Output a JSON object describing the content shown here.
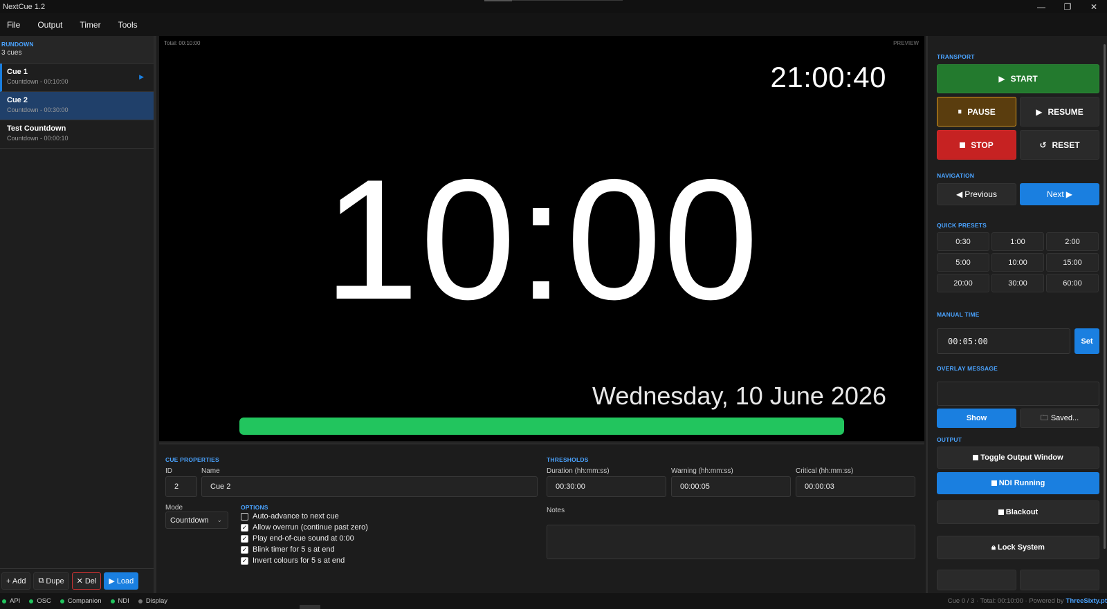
{
  "window": {
    "title": "NextCue  1.2",
    "controls": [
      "—",
      "❐",
      "✕"
    ]
  },
  "menu": [
    "File",
    "Output",
    "Timer",
    "Tools"
  ],
  "rundown": {
    "label": "RUNDOWN",
    "count": "3 cues",
    "cues": [
      {
        "name": "Cue 1",
        "sub": "Countdown - 00:10:00"
      },
      {
        "name": "Cue 2",
        "sub": "Countdown - 00:30:00"
      },
      {
        "name": "Test Countdown",
        "sub": "Countdown - 00:00:10"
      }
    ],
    "actions": {
      "add": "+ Add",
      "dupe": "Dupe",
      "del": "Del",
      "load": "Load"
    }
  },
  "preview": {
    "total_label": "Total:",
    "total_value": "00:10:00",
    "label": "PREVIEW",
    "clock": "21:00:40",
    "timer": "10:00",
    "date": "Wednesday, 10 June 2026",
    "progress": 1.0,
    "progress_color": "#22c55e"
  },
  "props": {
    "section": "CUE PROPERTIES",
    "id_label": "ID",
    "id_value": "2",
    "name_label": "Name",
    "name_value": "Cue 2",
    "mode_label": "Mode",
    "mode_value": "Countdown",
    "options_label": "OPTIONS",
    "options": [
      {
        "label": "Auto-advance to next cue",
        "checked": false
      },
      {
        "label": "Allow overrun (continue past zero)",
        "checked": true
      },
      {
        "label": "Play end-of-cue sound at 0:00",
        "checked": true
      },
      {
        "label": "Blink timer for 5 s at end",
        "checked": true
      },
      {
        "label": "Invert colours for 5 s at end",
        "checked": true
      }
    ],
    "thresholds_label": "THRESHOLDS",
    "duration_label": "Duration (hh:mm:ss)",
    "duration_value": "00:30:00",
    "warning_label": "Warning (hh:mm:ss)",
    "warning_value": "00:00:05",
    "critical_label": "Critical (hh:mm:ss)",
    "critical_value": "00:00:03",
    "notes_label": "Notes"
  },
  "transport": {
    "label": "TRANSPORT",
    "start": "START",
    "pause": "PAUSE",
    "resume": "RESUME",
    "stop": "STOP",
    "reset": "RESET"
  },
  "navigation": {
    "label": "NAVIGATION",
    "previous": "Previous",
    "next": "Next"
  },
  "presets": {
    "label": "QUICK PRESETS",
    "items": [
      "0:30",
      "1:00",
      "2:00",
      "5:00",
      "10:00",
      "15:00",
      "20:00",
      "30:00",
      "60:00"
    ]
  },
  "manual": {
    "label": "MANUAL TIME",
    "value": "00:05:00",
    "set": "Set"
  },
  "overlay": {
    "label": "OVERLAY MESSAGE",
    "show": "Show",
    "saved": "Saved..."
  },
  "output": {
    "label": "OUTPUT",
    "toggle": "Toggle Output Window",
    "ndi": "NDI Running",
    "blackout": "Blackout",
    "lock": "Lock System"
  },
  "status": {
    "items": [
      {
        "label": "API",
        "color": "#22c55e"
      },
      {
        "label": "OSC",
        "color": "#22c55e"
      },
      {
        "label": "Companion",
        "color": "#22c55e"
      },
      {
        "label": "NDI",
        "color": "#22c55e"
      },
      {
        "label": "Display",
        "color": "#777777"
      }
    ],
    "right": "Cue 0 / 3 · Total: 00:10:00 · Powered by",
    "brand": "ThreeSixty.pt"
  }
}
